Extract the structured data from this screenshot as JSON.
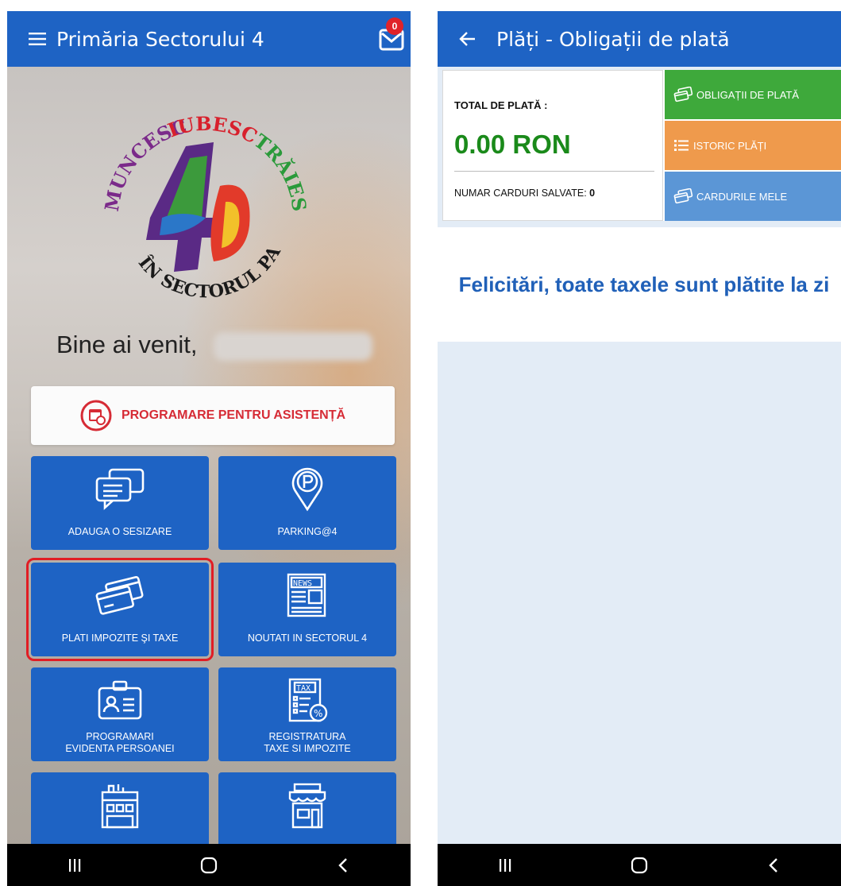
{
  "left_screen": {
    "app_title": "Primăria Sectorului 4",
    "mail_badge": "0",
    "logo": {
      "top_words": "MUNCESC • IUBESC • TRĂIESC",
      "bottom_words": "ÎN SECTORUL PATRU",
      "number": "4"
    },
    "welcome_text": "Bine ai venit,",
    "schedule_button_label": "PROGRAMARE PENTRU ASISTENȚĂ",
    "tiles": [
      {
        "label": "ADAUGA O SESIZARE",
        "icon": "chat-bubbles-icon"
      },
      {
        "label": "PARKING@4",
        "icon": "parking-pin-icon"
      },
      {
        "label": "PLATI IMPOZITE ŞI TAXE",
        "icon": "credit-cards-icon",
        "highlighted": true
      },
      {
        "label": "NOUTATI IN SECTORUL 4",
        "icon": "newspaper-icon"
      },
      {
        "label": "PROGRAMARI\nEVIDENTA PERSOANEI",
        "icon": "id-card-icon"
      },
      {
        "label": "REGISTRATURA\nTAXE SI IMPOZITE",
        "icon": "tax-document-icon"
      },
      {
        "label": "",
        "icon": "building-icon"
      },
      {
        "label": "",
        "icon": "shop-icon"
      }
    ],
    "highlight_color": "#e11d24"
  },
  "right_screen": {
    "app_title": "Plăți - Obligații de plată",
    "total_label": "TOTAL DE PLATĂ :",
    "total_value": "0.00 RON",
    "saved_cards_label": "NUMAR CARDURI SALVATE:",
    "saved_cards_count": "0",
    "buttons": [
      {
        "label": "OBLIGAȚII DE PLATĂ",
        "icon": "cards-icon",
        "color": "#3ea93b"
      },
      {
        "label": "ISTORIC PLĂȚI",
        "icon": "list-icon",
        "color": "#ef9a4c"
      },
      {
        "label": "CARDURILE MELE",
        "icon": "cards-icon",
        "color": "#5b96d6"
      }
    ],
    "success_message": "Felicitări, toate taxele sunt plătite la zi"
  },
  "colors": {
    "app_bar": "#1e63c4",
    "tile": "#1e63c4",
    "total_green": "#1a8a1a",
    "success_blue": "#2060b8"
  }
}
